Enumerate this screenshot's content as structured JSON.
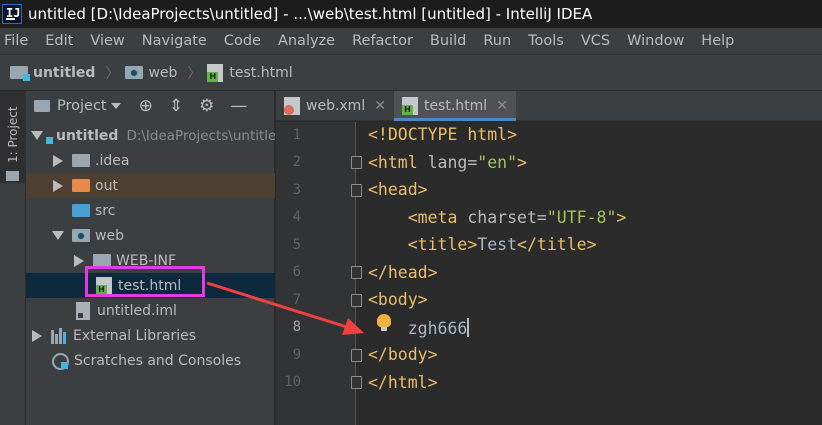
{
  "window": {
    "title": "untitled [D:\\IdeaProjects\\untitled] - ...\\web\\test.html [untitled] - IntelliJ IDEA"
  },
  "menu": [
    "File",
    "Edit",
    "View",
    "Navigate",
    "Code",
    "Analyze",
    "Refactor",
    "Build",
    "Run",
    "Tools",
    "VCS",
    "Window",
    "Help"
  ],
  "breadcrumb": [
    "untitled",
    "web",
    "test.html"
  ],
  "sidebar_tab": {
    "label": "1: Project"
  },
  "project_panel": {
    "title": "Project",
    "tree": [
      {
        "label": "untitled",
        "path": "D:\\IdeaProjects\\untitle",
        "icon": "project-folder-icon",
        "expanded": true
      },
      {
        "label": ".idea",
        "icon": "folder-icon"
      },
      {
        "label": "out",
        "icon": "excluded-folder-icon"
      },
      {
        "label": "src",
        "icon": "source-folder-icon"
      },
      {
        "label": "web",
        "icon": "web-folder-icon",
        "expanded": true
      },
      {
        "label": "WEB-INF",
        "icon": "folder-icon"
      },
      {
        "label": "test.html",
        "icon": "html-file-icon",
        "selected": true
      },
      {
        "label": "untitled.iml",
        "icon": "iml-file-icon"
      },
      {
        "label": "External Libraries",
        "icon": "libraries-icon"
      },
      {
        "label": "Scratches and Consoles",
        "icon": "scratches-icon"
      }
    ]
  },
  "editor": {
    "tabs": [
      {
        "label": "web.xml",
        "icon": "xml-file-icon",
        "active": false
      },
      {
        "label": "test.html",
        "icon": "html-file-icon",
        "active": true
      }
    ],
    "line_numbers": [
      "1",
      "2",
      "3",
      "4",
      "5",
      "6",
      "7",
      "8",
      "9",
      "10"
    ],
    "code": {
      "l1": {
        "tag": "<!DOCTYPE html>"
      },
      "l2": {
        "open": "<html ",
        "attr": "lang=",
        "val": "\"en\"",
        "close": ">"
      },
      "l3": {
        "tag": "<head>"
      },
      "l4": {
        "indent": "    ",
        "open": "<meta ",
        "attr": "charset=",
        "val": "\"UTF-8\"",
        "close": ">"
      },
      "l5": {
        "indent": "    ",
        "open": "<title>",
        "text": "Test",
        "close": "</title>"
      },
      "l6": {
        "tag": "</head>"
      },
      "l7": {
        "tag": "<body>"
      },
      "l8": {
        "indent": "    ",
        "text": "zgh666"
      },
      "l9": {
        "tag": "</body>"
      },
      "l10": {
        "tag": "</html>"
      }
    }
  },
  "colors": {
    "tag": "#e8bf6a",
    "attribute": "#bababa",
    "string": "#a5c25c",
    "text": "#a9b7c6",
    "highlight_box": "#e23be2",
    "annotation_arrow": "#f04040",
    "selection": "#0d293e"
  }
}
